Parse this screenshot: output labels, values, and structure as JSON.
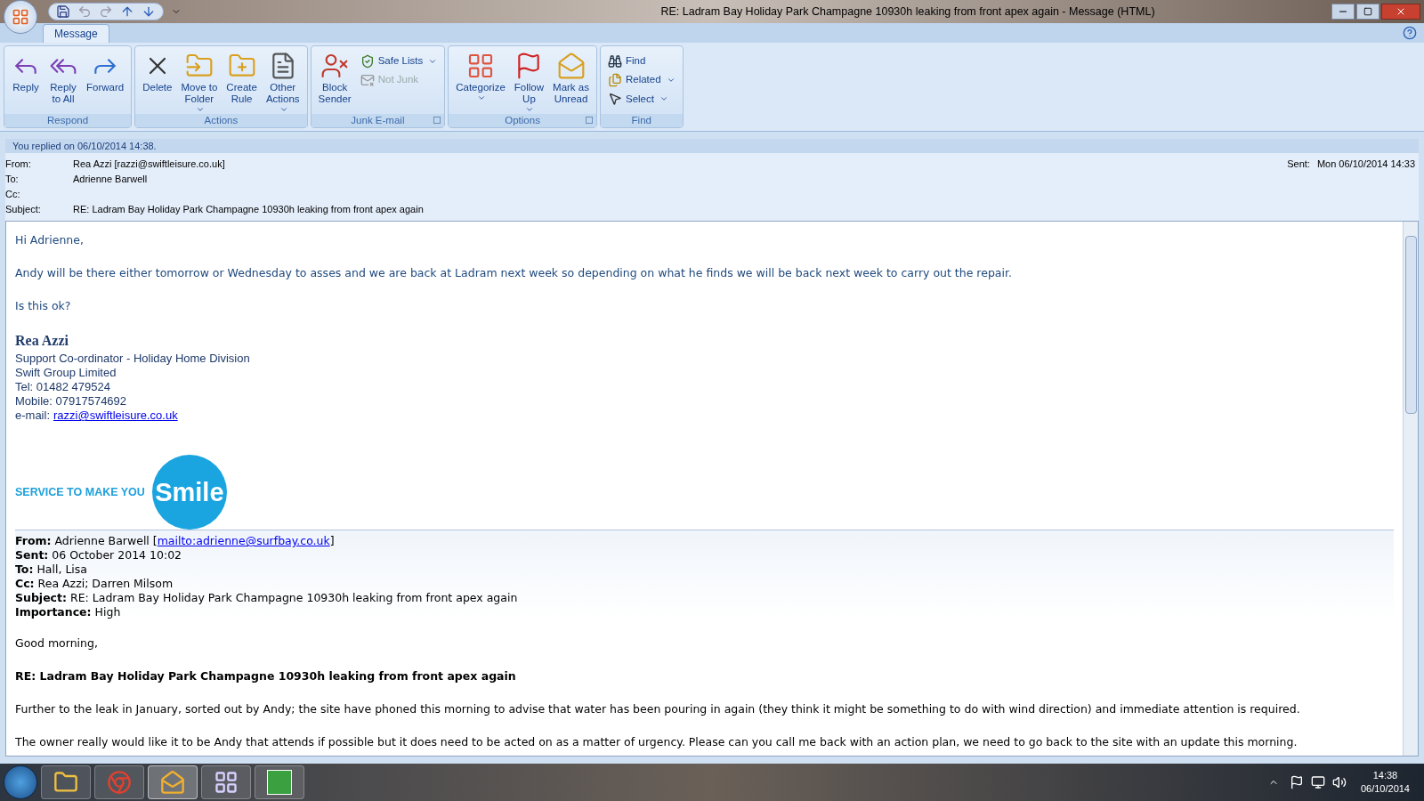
{
  "window": {
    "title": "RE: Ladram Bay Holiday Park Champagne 10930h leaking from front apex again - Message (HTML)"
  },
  "tabs": [
    {
      "label": "Message",
      "selected": true
    }
  ],
  "ribbon": {
    "groups": [
      {
        "label": "Respond",
        "launcher": false,
        "buttons": [
          {
            "label": "Reply",
            "dropdown": false,
            "disabled": false
          },
          {
            "label": "Reply\nto All",
            "dropdown": false,
            "disabled": false
          },
          {
            "label": "Forward",
            "dropdown": false,
            "disabled": false
          }
        ]
      },
      {
        "label": "Actions",
        "launcher": false,
        "buttons": [
          {
            "label": "Delete",
            "dropdown": false,
            "disabled": false
          },
          {
            "label": "Move to\nFolder",
            "dropdown": true,
            "disabled": false
          },
          {
            "label": "Create\nRule",
            "dropdown": false,
            "disabled": false
          },
          {
            "label": "Other\nActions",
            "dropdown": true,
            "disabled": false
          }
        ]
      },
      {
        "label": "Junk E-mail",
        "launcher": true,
        "buttons": [
          {
            "label": "Block\nSender",
            "dropdown": false,
            "disabled": false
          }
        ],
        "small_buttons": [
          {
            "label": "Safe Lists",
            "dropdown": true,
            "disabled": false
          },
          {
            "label": "Not Junk",
            "dropdown": false,
            "disabled": true
          }
        ]
      },
      {
        "label": "Options",
        "launcher": true,
        "buttons": [
          {
            "label": "Categorize",
            "dropdown": true,
            "disabled": false
          },
          {
            "label": "Follow\nUp",
            "dropdown": true,
            "disabled": false
          },
          {
            "label": "Mark as\nUnread",
            "dropdown": false,
            "disabled": false
          }
        ]
      },
      {
        "label": "Find",
        "launcher": false,
        "small_buttons": [
          {
            "label": "Find",
            "dropdown": false,
            "disabled": false
          },
          {
            "label": "Related",
            "dropdown": true,
            "disabled": false
          },
          {
            "label": "Select",
            "dropdown": true,
            "disabled": false
          }
        ]
      }
    ]
  },
  "info_bar": "You replied on 06/10/2014 14:38.",
  "header": {
    "fields": [
      {
        "label": "From:",
        "value": "Rea Azzi [razzi@swiftleisure.co.uk]"
      },
      {
        "label": "To:",
        "value": "Adrienne Barwell"
      },
      {
        "label": "Cc:"
      },
      {
        "label": "Subject:",
        "value": "RE: Ladram Bay Holiday Park Champagne 10930h leaking from front apex again"
      }
    ],
    "sent_label": "Sent:",
    "sent_value": "Mon 06/10/2014 14:33"
  },
  "body": {
    "reply_paragraphs": [
      "Hi Adrienne,",
      "Andy will be there either tomorrow or Wednesday  to asses and we are back at Ladram next week so depending on what he finds we will be back next week to carry out the repair.",
      "Is this ok?"
    ],
    "signature": {
      "name": "Rea Azzi",
      "lines": [
        "Support Co-ordinator - Holiday Home Division",
        "Swift Group Limited",
        "Tel: 01482 479524",
        "Mobile: 07917574692"
      ],
      "email_label": "e-mail:",
      "email": "razzi@swiftleisure.co.uk",
      "logo_tagline": "SERVICE TO MAKE YOU",
      "logo_word": "Smile"
    },
    "quoted_header": [
      {
        "label": "From:",
        "value": "Adrienne Barwell [",
        "link": "mailto:adrienne@surfbay.co.uk",
        "after": "]"
      },
      {
        "label": "Sent:",
        "value": "06 October 2014 10:02"
      },
      {
        "label": "To:",
        "value": "Hall, Lisa"
      },
      {
        "label": "Cc:",
        "value": "Rea Azzi; Darren Milsom"
      },
      {
        "label": "Subject:",
        "value": "RE: Ladram Bay Holiday Park Champagne 10930h leaking from front apex again"
      },
      {
        "label": "Importance:",
        "value": "High"
      }
    ],
    "quoted_paragraphs": [
      {
        "text": "Good morning,",
        "bold": false
      },
      {
        "text": "RE: Ladram Bay Holiday Park Champagne 10930h leaking from front apex again",
        "bold": true
      },
      {
        "text": "Further to the leak in January, sorted out by Andy; the site have phoned this morning to advise that water has been pouring in again  (they think it might be something to do with wind direction)  and immediate  attention is required.",
        "bold": false
      },
      {
        "text": "The owner really would like it to be Andy that attends if possible but it does need to be acted on as a matter of urgency.  Please can you call me back with an action plan, we need to go back to the site with an update this morning.",
        "bold": false
      }
    ]
  },
  "taskbar": {
    "time": "14:38",
    "date": "06/10/2014"
  }
}
